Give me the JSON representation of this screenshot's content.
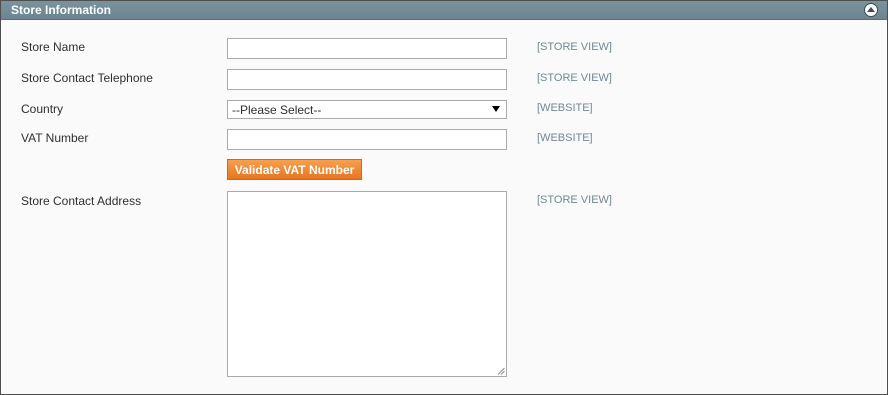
{
  "section": {
    "title": "Store Information",
    "collapse_icon": "chevron-up-circle-icon"
  },
  "fields": {
    "store_name": {
      "label": "Store Name",
      "value": "",
      "scope": "[STORE VIEW]"
    },
    "store_phone": {
      "label": "Store Contact Telephone",
      "value": "",
      "scope": "[STORE VIEW]"
    },
    "country": {
      "label": "Country",
      "selected": "--Please Select--",
      "scope": "[WEBSITE]"
    },
    "vat_number": {
      "label": "VAT Number",
      "value": "",
      "scope": "[WEBSITE]"
    },
    "validate_button": {
      "label": "Validate VAT Number"
    },
    "store_address": {
      "label": "Store Contact Address",
      "value": "",
      "scope": "[STORE VIEW]"
    }
  },
  "colors": {
    "header_bg": "#6b8590",
    "scope_text": "#6f8992",
    "button_bg": "#f08a2b"
  }
}
